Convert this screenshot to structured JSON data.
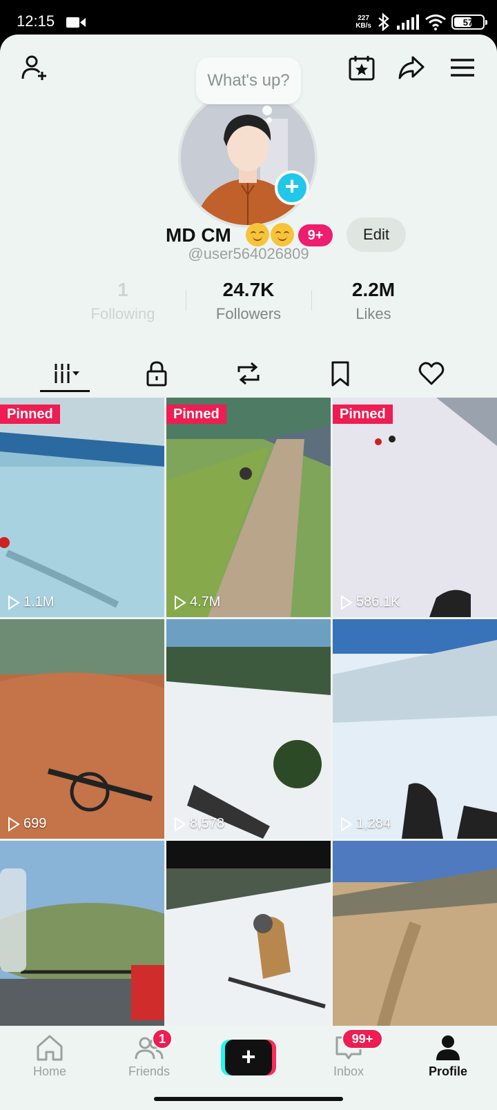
{
  "status_bar": {
    "time": "12:15",
    "speed_top": "227",
    "speed_bottom": "KB/s",
    "battery": "57"
  },
  "profile": {
    "bubble_text": "What's up?",
    "name": "MD CM",
    "badge": "9+",
    "edit_label": "Edit",
    "handle": "@user564026809"
  },
  "stats": [
    {
      "value": "1",
      "label": "Following"
    },
    {
      "value": "24.7K",
      "label": "Followers"
    },
    {
      "value": "2.2M",
      "label": "Likes"
    }
  ],
  "tabs": [
    "videos-tab",
    "private-tab",
    "reposts-tab",
    "favorites-tab",
    "liked-tab"
  ],
  "grid": [
    {
      "pinned": "Pinned",
      "views": "1.1M"
    },
    {
      "pinned": "Pinned",
      "views": "4.7M"
    },
    {
      "pinned": "Pinned",
      "views": "586.1K"
    },
    {
      "views": "699"
    },
    {
      "views": "8,578"
    },
    {
      "views": "1,284"
    }
  ],
  "nav": {
    "home": "Home",
    "friends": "Friends",
    "friends_badge": "1",
    "inbox": "Inbox",
    "inbox_badge": "99+",
    "profile": "Profile"
  },
  "colors": {
    "accent_pink": "#ee1d52",
    "accent_cyan": "#21c7e9",
    "background": "#eef4f2"
  }
}
